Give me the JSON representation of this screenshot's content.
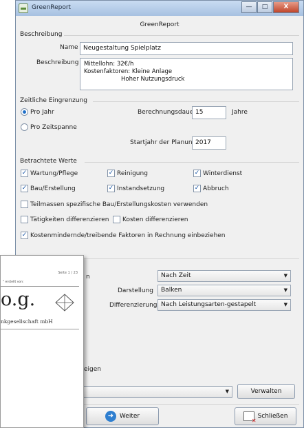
{
  "window": {
    "title": "GreenReport",
    "heading": "GreenReport"
  },
  "controls": {
    "min": "—",
    "max": "□",
    "close": "X"
  },
  "beschreibung": {
    "section": "Beschreibung",
    "name_label": "Name",
    "name_value": "Neugestaltung Spielplatz",
    "desc_label": "Beschreibung",
    "desc_lines": [
      "Mittellohn: 32€/h",
      "Kostenfaktoren: Kleine Anlage",
      "                    Hoher Nutzungsdruck"
    ]
  },
  "zeit": {
    "section": "Zeitliche Eingrenzung",
    "pro_jahr": "Pro Jahr",
    "pro_zeitspanne": "Pro Zeitspanne",
    "dauer_label": "Berechnungsdauer",
    "dauer_value": "15",
    "dauer_unit": "Jahre",
    "start_label": "Startjahr der Planung",
    "start_value": "2017"
  },
  "werte": {
    "section": "Betrachtete Werte",
    "wartung": "Wartung/Pflege",
    "reinigung": "Reinigung",
    "winterdienst": "Winterdienst",
    "bau": "Bau/Erstellung",
    "instandsetzung": "Instandsetzung",
    "abbruch": "Abbruch",
    "teilmassen": "Teilmassen spezifische Bau/Erstellungskosten verwenden",
    "taetigkeiten": "Tätigkeiten differenzieren",
    "kosten_diff": "Kosten differenzieren",
    "kostenmindernd": "Kostenmindernde/treibende Faktoren in Rechnung einbeziehen"
  },
  "darstellung": {
    "partial_label": "n",
    "select1": "Nach Zeit",
    "darstellung_label": "Darstellung",
    "select2": "Balken",
    "diff_label": "Differenzierung",
    "select3": "Nach Leistungsarten-gestapelt",
    "partial_text": "eigen"
  },
  "footer": {
    "verwalten": "Verwalten",
    "weiter": "Weiter",
    "schliessen": "Schließen"
  },
  "paper": {
    "seite": "Seite 1 / 23",
    "prepared": "\" erstellt von:",
    "logo": "o.g.",
    "company": "nkgesellschaft mbH"
  }
}
